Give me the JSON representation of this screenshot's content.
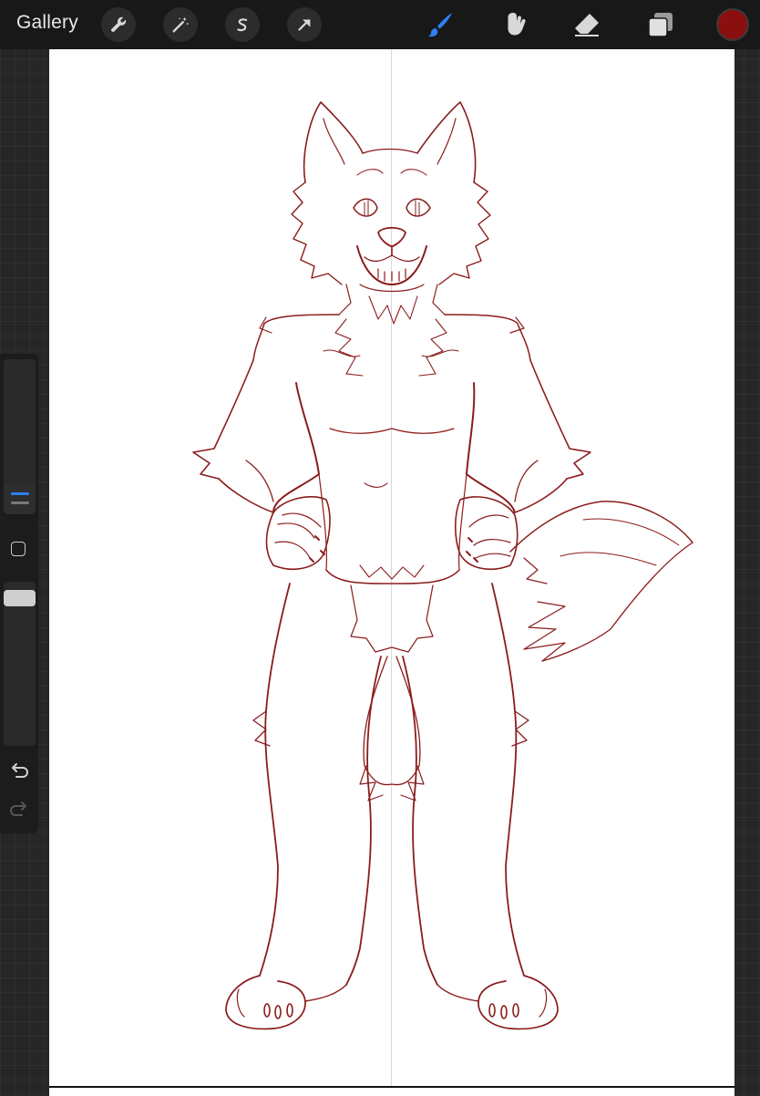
{
  "topbar": {
    "gallery_label": "Gallery",
    "left_tools": [
      "wrench-icon",
      "magic-wand-icon",
      "selection-icon",
      "transform-arrow-icon"
    ],
    "right_tools": [
      "brush-icon",
      "smudge-icon",
      "eraser-icon",
      "layers-icon"
    ],
    "active_tool": "brush",
    "current_color": "#8b0f0f"
  },
  "sidebar": {
    "controls": [
      "brush-size-slider",
      "modify-button",
      "opacity-slider",
      "undo-icon",
      "redo-icon"
    ]
  },
  "canvas": {
    "background": "#ffffff",
    "sketch_color": "#8b1c1c",
    "has_center_guide": true
  },
  "colors": {
    "accent_blue": "#2e7ff5",
    "toolbar_bg": "#181818",
    "workspace_bg": "#262626"
  }
}
